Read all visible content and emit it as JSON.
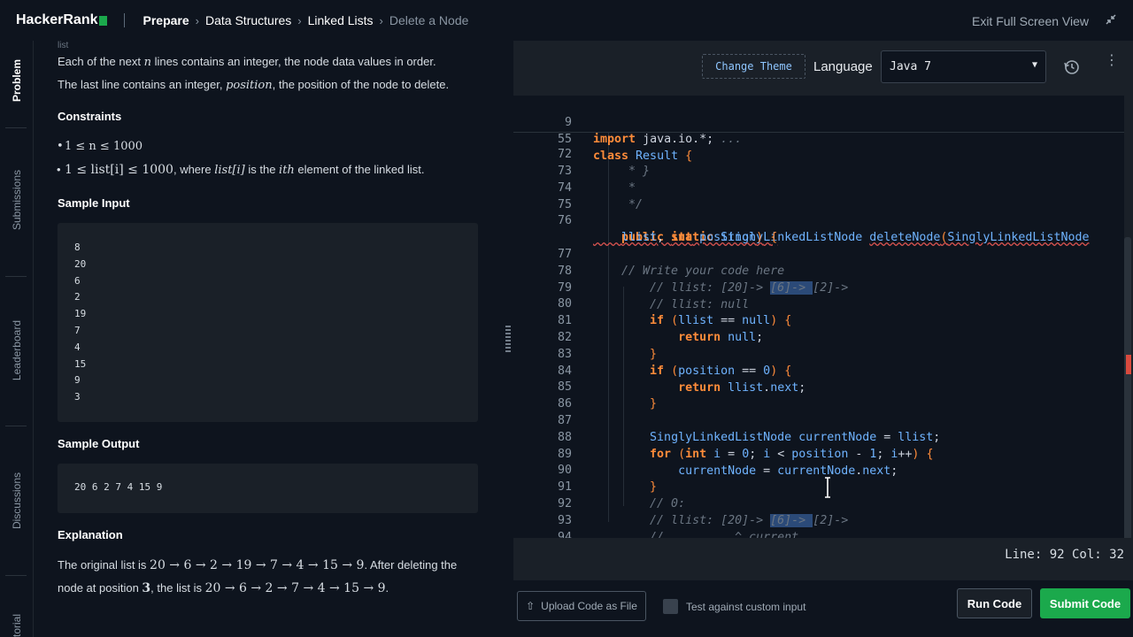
{
  "header": {
    "logo": "HackerRank",
    "breadcrumbs": [
      "Prepare",
      "Data Structures",
      "Linked Lists",
      "Delete a Node"
    ],
    "exit_label": "Exit Full Screen View"
  },
  "rail": {
    "tabs": [
      "Problem",
      "Submissions",
      "Leaderboard",
      "Discussions",
      "Editorial"
    ]
  },
  "problem": {
    "top_fragment": "list",
    "line1_a": "Each of the next ",
    "line1_var": "n",
    "line1_b": " lines contains an integer, the node data values in order.",
    "line2_a": "The last line contains an integer, ",
    "line2_var": "position",
    "line2_b": ", the position of the node to delete.",
    "constraints_heading": "Constraints",
    "constraint1": "1 ≤ n ≤ 1000",
    "constraint2_math": "1 ≤ list[i] ≤ 1000",
    "constraint2_a": ", where ",
    "constraint2_var": "list[i]",
    "constraint2_b": " is the ",
    "constraint2_ith": "ith",
    "constraint2_c": " element of the linked list.",
    "sample_input_heading": "Sample Input",
    "sample_input": [
      "8",
      "20",
      "6",
      "2",
      "19",
      "7",
      "4",
      "15",
      "9",
      "3"
    ],
    "sample_output_heading": "Sample Output",
    "sample_output": "20 6 2 7 4 15 9",
    "explanation_heading": "Explanation",
    "expl_line1_a": "The original list is ",
    "expl_line1_math": "20 → 6 → 2 → 19 → 7 → 4 → 15 → 9",
    "expl_line1_b": ". After deleting the",
    "expl_line2_a": "node at position ",
    "expl_line2_pos": "3",
    "expl_line2_b": ", the list is ",
    "expl_line2_math": "20 → 6 → 2 → 7 → 4 → 15 → 9",
    "expl_line2_c": "."
  },
  "editor": {
    "change_theme": "Change Theme",
    "language_label": "Language",
    "language_value": "Java 7",
    "status": "Line: 92 Col: 32",
    "upload_label": "Upload Code as File",
    "custom_input_label": "Test against custom input",
    "run_label": "Run Code",
    "submit_label": "Submit Code",
    "sticky_lines": [
      {
        "n": "9",
        "t": "import java.io.*;"
      },
      {
        "n": "55",
        "t": "class Result {"
      }
    ],
    "lines": [
      {
        "n": "72",
        "t": "     * }"
      },
      {
        "n": "73",
        "t": "     *"
      },
      {
        "n": "74",
        "t": "     */"
      },
      {
        "n": "75",
        "t": ""
      },
      {
        "n": "76",
        "t": "    public static SinglyLinkedListNode deleteNode(SinglyLinkedListNode"
      },
      {
        "n": "",
        "t": "    llist, int position) {"
      },
      {
        "n": "77",
        "t": "    // Write your code here"
      },
      {
        "n": "78",
        "t": "        // llist: [20]-> [6]-> [2]->"
      },
      {
        "n": "79",
        "t": "        // llist: null"
      },
      {
        "n": "80",
        "t": "        if (llist == null) {"
      },
      {
        "n": "81",
        "t": "            return null;"
      },
      {
        "n": "82",
        "t": "        }"
      },
      {
        "n": "83",
        "t": "        if (position == 0) {"
      },
      {
        "n": "84",
        "t": "            return llist.next;"
      },
      {
        "n": "85",
        "t": "        }"
      },
      {
        "n": "86",
        "t": ""
      },
      {
        "n": "87",
        "t": "        SinglyLinkedListNode currentNode = llist;"
      },
      {
        "n": "88",
        "t": "        for (int i = 0; i < position - 1; i++) {"
      },
      {
        "n": "89",
        "t": "            currentNode = currentNode.next;"
      },
      {
        "n": "90",
        "t": "        }"
      },
      {
        "n": "91",
        "t": "        // 0:"
      },
      {
        "n": "92",
        "t": "        // llist: [20]-> [6]-> [2]->"
      },
      {
        "n": "93",
        "t": "        //          ^ current"
      },
      {
        "n": "94",
        "t": "    }"
      },
      {
        "n": "95",
        "t": ""
      }
    ]
  },
  "colors": {
    "accent_green": "#1ba94c",
    "keyword": "#ff8c3a",
    "type": "#6fb3ff",
    "comment": "#6a7582"
  }
}
